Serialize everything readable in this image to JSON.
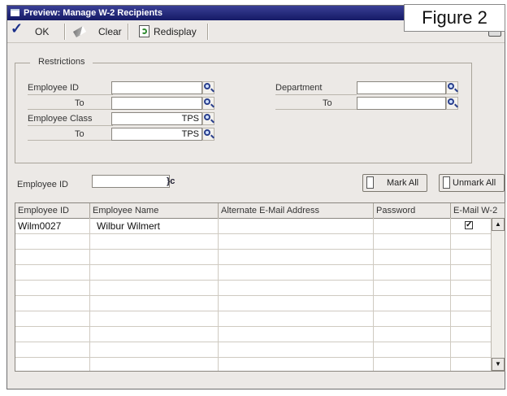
{
  "window": {
    "title": "Preview: Manage W-2 Recipients"
  },
  "figure_label": "Figure 2",
  "toolbar": {
    "ok_label": "OK",
    "clear_label": "Clear",
    "redisplay_label": "Redisplay"
  },
  "restrictions": {
    "legend": "Restrictions",
    "employee_id_label": "Employee ID",
    "employee_id_value": "",
    "employee_id_to_label": "To",
    "employee_id_to_value": "",
    "employee_class_label": "Employee Class",
    "employee_class_value": "TPS",
    "employee_class_to_label": "To",
    "employee_class_to_value": "TPS",
    "department_label": "Department",
    "department_value": "",
    "department_to_label": "To",
    "department_to_value": ""
  },
  "search": {
    "label": "Employee ID",
    "value": ""
  },
  "buttons": {
    "mark_all": "Mark All",
    "unmark_all": "Unmark All"
  },
  "grid": {
    "columns": [
      "Employee ID",
      "Employee Name",
      "Alternate E-Mail Address",
      "Password",
      "E-Mail W-2"
    ],
    "rows": [
      {
        "employee_id": "Wilm0027",
        "employee_name": "Wilbur Wilmert",
        "alt_email": "",
        "password": "",
        "email_w2": true
      }
    ]
  }
}
